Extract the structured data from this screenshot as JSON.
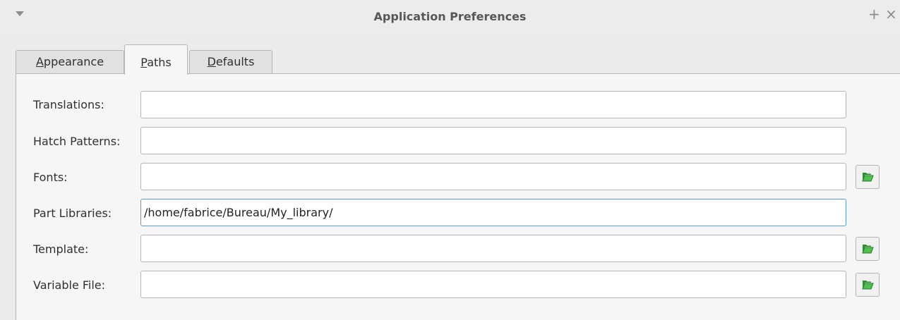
{
  "window": {
    "title": "Application Preferences",
    "menu_icon": "triangle-down-icon",
    "plus_glyph": "+",
    "close_glyph": "×"
  },
  "tabs": [
    {
      "label_mnemonic": "A",
      "label_rest": "ppearance",
      "active": false
    },
    {
      "label_mnemonic": "P",
      "label_rest": "aths",
      "active": true
    },
    {
      "label_mnemonic": "D",
      "label_rest": "efaults",
      "active": false
    }
  ],
  "paths": {
    "translations": {
      "label": "Translations:",
      "value": ""
    },
    "hatch_patterns": {
      "label": "Hatch Patterns:",
      "value": ""
    },
    "fonts": {
      "label": "Fonts:",
      "value": ""
    },
    "part_libraries": {
      "label": "Part Libraries:",
      "value": "/home/fabrice/Bureau/My_library/"
    },
    "template": {
      "label": "Template:",
      "value": ""
    },
    "variable_file": {
      "label": "Variable File:",
      "value": ""
    }
  },
  "icons": {
    "browse": "folder-open-icon"
  },
  "colors": {
    "folder_green": "#3aa53a",
    "focus_border": "#5b9bd5"
  }
}
